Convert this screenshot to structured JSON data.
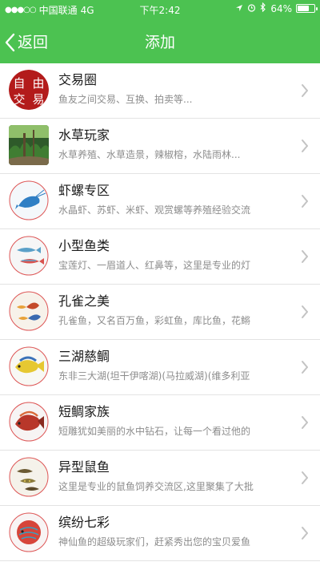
{
  "status_bar": {
    "carrier": "中国联通",
    "network": "4G",
    "time": "下午2:42",
    "battery": "64%",
    "battery_level": 0.64
  },
  "nav": {
    "back_label": "返回",
    "title": "添加"
  },
  "logo_text": [
    "自",
    "由",
    "交",
    "易"
  ],
  "colors": {
    "header_bg": "#4cc251",
    "title_text": "#1a1a1a",
    "desc_text": "#8c8c8c",
    "divider": "#e3e3e3",
    "chevron": "#c3c3c3"
  },
  "groups": [
    {
      "title": "交易圈",
      "desc": "鱼友之间交易、互换、拍卖等...",
      "icon": "free-trade-logo-icon"
    },
    {
      "title": "水草玩家",
      "desc": "水草养殖、水草造景，辣椒榕，水陆雨林...",
      "icon": "aquascape-photo-icon"
    },
    {
      "title": "虾螺专区",
      "desc": "水晶虾、苏虾、米虾、观赏螺等养殖经验交流",
      "icon": "shrimp-photo-icon"
    },
    {
      "title": "小型鱼类",
      "desc": "宝莲灯、一眉道人、红鼻等，这里是专业的灯",
      "icon": "small-fish-photo-icon"
    },
    {
      "title": "孔雀之美",
      "desc": "孔雀鱼，又名百万鱼，彩虹鱼，库比鱼，花鳉",
      "icon": "guppy-photo-icon"
    },
    {
      "title": "三湖慈鲷",
      "desc": "东非三大湖(坦干伊喀湖)(马拉威湖)(维多利亚",
      "icon": "cichlid-photo-icon"
    },
    {
      "title": "短鲷家族",
      "desc": "短雕犹如美丽的水中钻石，让每一个看过他的",
      "icon": "dwarf-cichlid-photo-icon"
    },
    {
      "title": "异型鼠鱼",
      "desc": "这里是专业的鼠鱼饲养交流区,这里聚集了大批",
      "icon": "catfish-photo-icon"
    },
    {
      "title": "缤纷七彩",
      "desc": "神仙鱼的超级玩家们，赶紧秀出您的宝贝爱鱼",
      "icon": "discus-photo-icon"
    }
  ]
}
